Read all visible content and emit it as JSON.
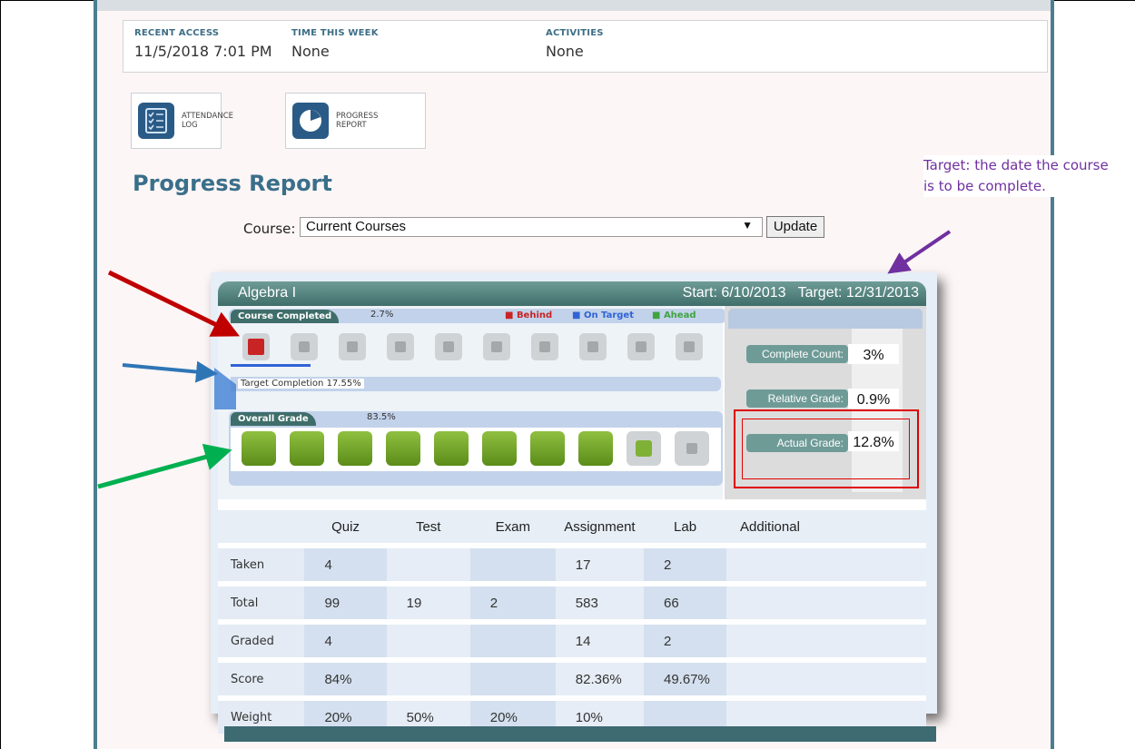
{
  "access": {
    "recent_label": "RECENT ACCESS",
    "recent_value": "11/5/2018 7:01 PM",
    "time_label": "TIME THIS WEEK",
    "time_value": "None",
    "activities_label": "ACTIVITIES",
    "activities_value": "None"
  },
  "tiles": [
    {
      "label": "ATTENDANCE LOG",
      "icon": "checklist-icon"
    },
    {
      "label": "PROGRESS REPORT",
      "icon": "pie-chart-icon"
    }
  ],
  "page_title": "Progress Report",
  "course_filter": {
    "label": "Course:",
    "selected": "Current Courses",
    "update_label": "Update"
  },
  "card": {
    "course_name": "Algebra I",
    "dates": "Start: 6/10/2013   Target: 12/31/2013",
    "course_completed_label": "Course Completed",
    "course_completed_value": "2.7%",
    "legend": {
      "behind": "Behind",
      "on_target": "On Target",
      "ahead": "Ahead"
    },
    "legend_colors": {
      "behind": "#c82424",
      "on_target": "#2f63d6",
      "ahead": "#3fa33f"
    },
    "target_completion": "Target Completion 17.55%",
    "overall_grade_label": "Overall Grade",
    "overall_grade_value": "83.5%",
    "stats": {
      "complete_count_label": "Complete Count:",
      "complete_count_value": "3%",
      "relative_grade_label": "Relative Grade:",
      "relative_grade_value": "0.9%",
      "actual_grade_label": "Actual Grade:",
      "actual_grade_value": "12.8%"
    }
  },
  "table": {
    "headers": [
      "",
      "Quiz",
      "Test",
      "Exam",
      "Assignment",
      "Lab",
      "Additional"
    ],
    "rows": [
      {
        "label": "Taken",
        "cells": [
          "4",
          "",
          "",
          "17",
          "2",
          ""
        ]
      },
      {
        "label": "Total",
        "cells": [
          "99",
          "19",
          "2",
          "583",
          "66",
          ""
        ]
      },
      {
        "label": "Graded",
        "cells": [
          "4",
          "",
          "",
          "14",
          "2",
          ""
        ]
      },
      {
        "label": "Score",
        "cells": [
          "84%",
          "",
          "",
          "82.36%",
          "49.67%",
          ""
        ]
      },
      {
        "label": "Weight",
        "cells": [
          "20%",
          "50%",
          "20%",
          "10%",
          "",
          ""
        ]
      }
    ]
  },
  "annotation": {
    "note": "Target: the date the course is to be complete.",
    "colors": {
      "red": "#c00000",
      "blue": "#2e75b6",
      "green": "#00b050",
      "purple": "#7030a0"
    }
  }
}
